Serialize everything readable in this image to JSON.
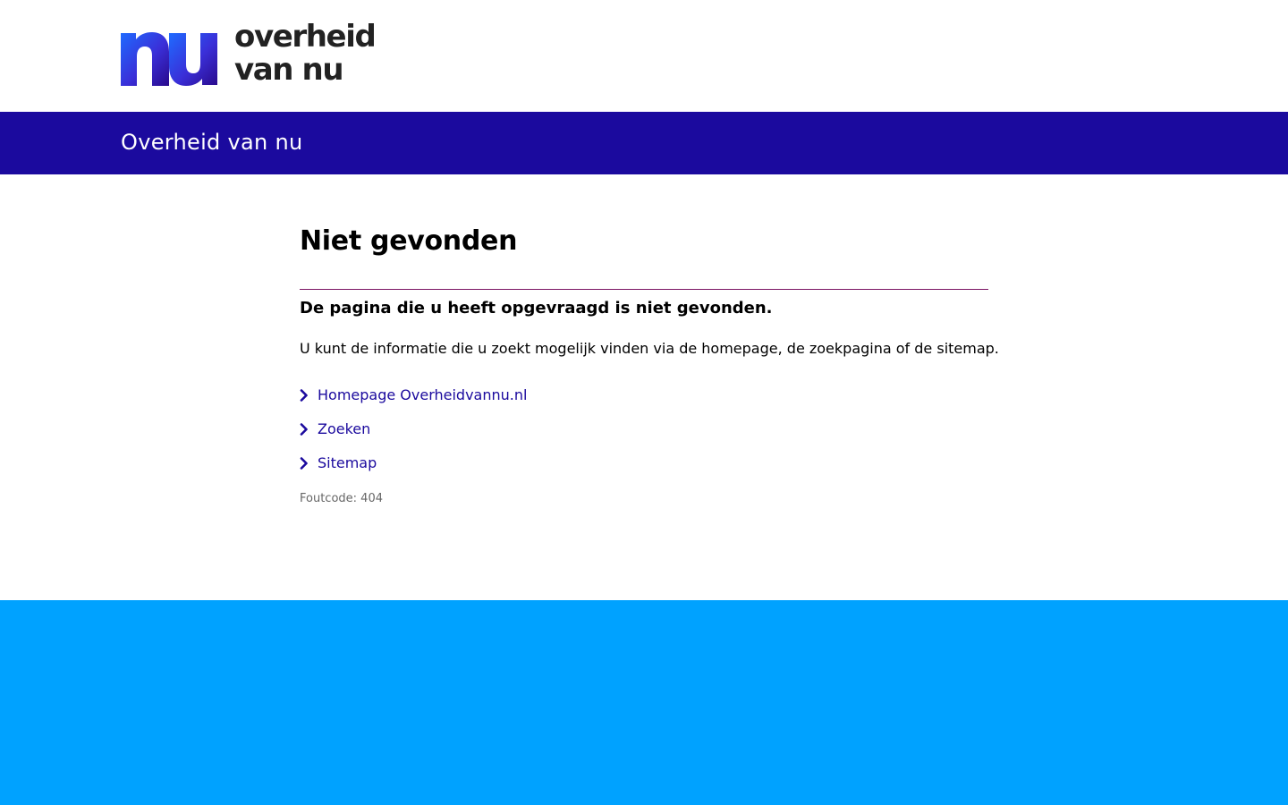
{
  "header": {
    "logo": {
      "line1": "overheid",
      "line2": "van nu",
      "mark_text": "nu"
    }
  },
  "banner": {
    "title": "Overheid van nu"
  },
  "main": {
    "title": "Niet gevonden",
    "lead": "De pagina die u heeft opgevraagd is niet gevonden.",
    "info": "U kunt de informatie die u zoekt mogelijk vinden via de homepage, de zoekpagina of de sitemap.",
    "links": [
      {
        "label": "Homepage Overheidvannu.nl",
        "icon": "chevron-right-icon"
      },
      {
        "label": "Zoeken",
        "icon": "chevron-right-icon"
      },
      {
        "label": "Sitemap",
        "icon": "chevron-right-icon"
      }
    ],
    "error_code": "Foutcode: 404"
  },
  "colors": {
    "brand_dark": "#1b0a9e",
    "footer": "#00a2ff",
    "divider": "#7b1463",
    "logo_gradient_start": "#1f6bff",
    "logo_gradient_end": "#2a0a8c"
  }
}
